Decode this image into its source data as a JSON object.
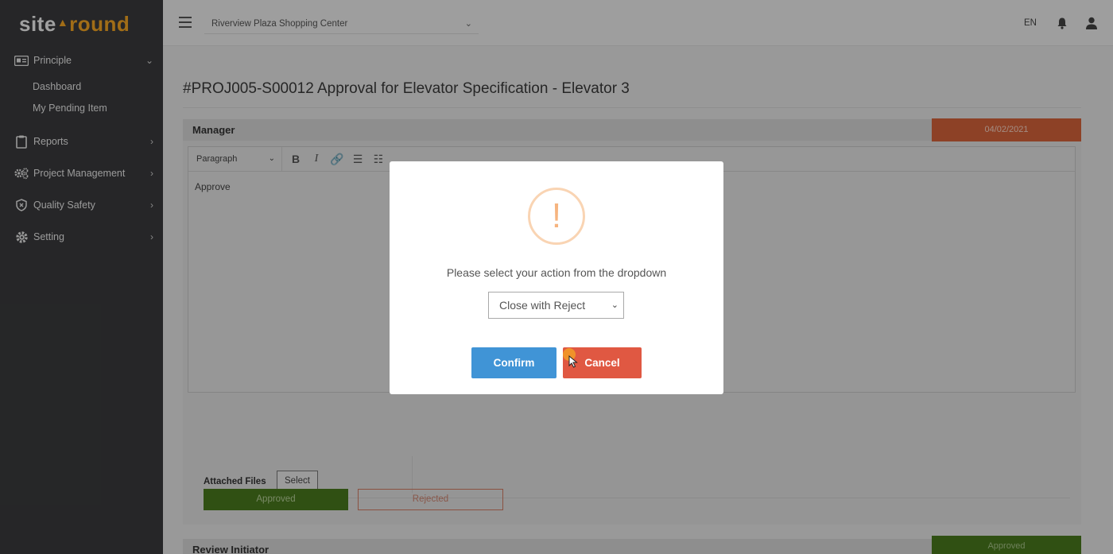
{
  "app": {
    "logo_left": "site",
    "logo_right": "round",
    "logo_mark": "▲"
  },
  "sidebar": {
    "items": [
      {
        "label": "Principle",
        "icon": "id-card-icon",
        "expanded": true
      },
      {
        "label": "Reports",
        "icon": "clipboard-icon"
      },
      {
        "label": "Project Management",
        "icon": "gears-icon"
      },
      {
        "label": "Quality Safety",
        "icon": "shield-icon"
      },
      {
        "label": "Setting",
        "icon": "gear-icon"
      }
    ],
    "principle_sub": [
      "Dashboard",
      "My Pending Item"
    ]
  },
  "topbar": {
    "project": "Riverview Plaza Shopping Center",
    "language": "EN"
  },
  "page": {
    "title": "#PROJ005-S00012 Approval for Elevator Specification - Elevator 3"
  },
  "manager_section": {
    "label": "Manager",
    "date": "04/02/2021",
    "date_color": "#d7633a",
    "editor_format": "Paragraph",
    "editor_text": "Approve",
    "attached_label": "Attached Files",
    "select_label": "Select",
    "approved_label": "Approved",
    "rejected_label": "Rejected"
  },
  "review_section": {
    "label": "Review Initiator",
    "status": "Approved",
    "status_color": "#4a7a1e"
  },
  "modal": {
    "icon": "exclamation-icon",
    "message": "Please select your action from the dropdown",
    "selected_action": "Close with Reject",
    "confirm_label": "Confirm",
    "cancel_label": "Cancel",
    "confirm_color": "#4094d6",
    "cancel_color": "#e05842"
  }
}
